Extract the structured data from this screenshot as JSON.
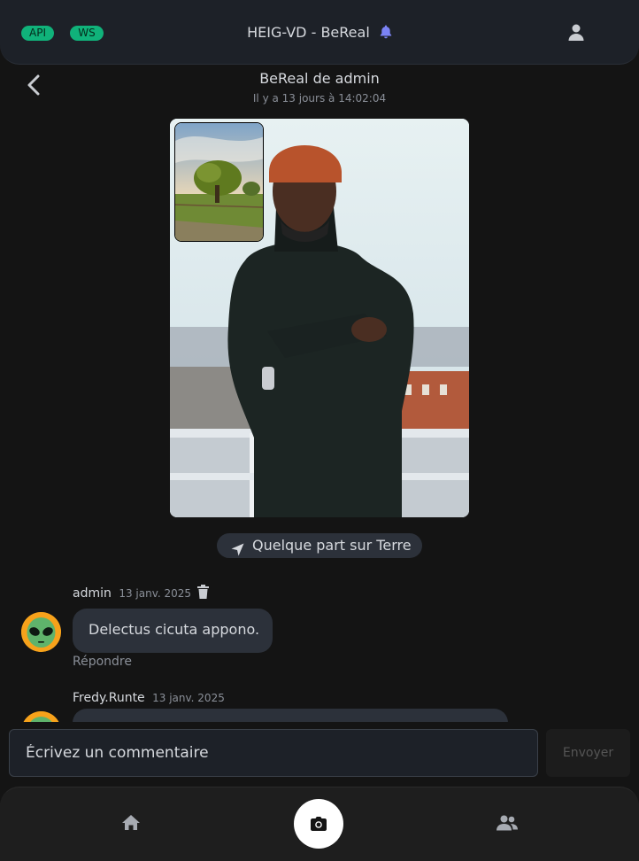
{
  "header": {
    "badges": [
      "API",
      "WS"
    ],
    "title": "HEIG-VD - BeReal",
    "icons": [
      "bell-icon",
      "user-icon"
    ]
  },
  "post": {
    "title": "BeReal de admin",
    "time": "Il y a 13 jours à 14:02:04",
    "location": "Quelque part sur Terre"
  },
  "comments": [
    {
      "author": "admin",
      "date": "13 janv. 2025",
      "text": "Delectus cicuta appono.",
      "reply_label": "Répondre"
    },
    {
      "author": "Fredy.Runte",
      "date": "13 janv. 2025",
      "text": ""
    }
  ],
  "composer": {
    "placeholder": "Écrivez un commentaire",
    "send_label": "Envoyer"
  },
  "nav": {
    "icons": [
      "home-icon",
      "camera-icon",
      "friends-icon"
    ]
  },
  "colors": {
    "background": "#141414",
    "badge_green": "#10b27a",
    "bell_purple": "#7b83f5",
    "avatar_orange": "#f7a21b"
  }
}
